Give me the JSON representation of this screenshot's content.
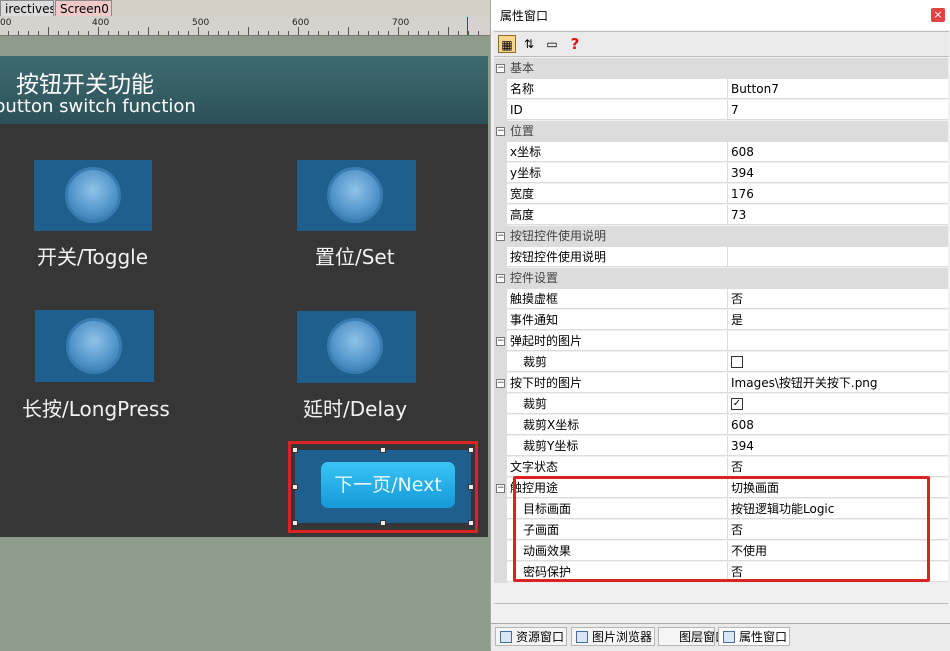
{
  "tabs": {
    "directives": "irectives",
    "screen0": "Screen0"
  },
  "ruler": {
    "labels": [
      "400",
      "500",
      "600",
      "700"
    ]
  },
  "screen": {
    "title_cn": "按钮开关功能",
    "title_en": "button switch function",
    "buttons": [
      {
        "caption": "开关/Toggle"
      },
      {
        "caption": "置位/Set"
      },
      {
        "caption": "长按/LongPress"
      },
      {
        "caption": "延时/Delay"
      }
    ],
    "next_label": "下一页/Next"
  },
  "prop_window": {
    "title": "属性窗口",
    "close": "×",
    "help": "?",
    "categories": {
      "basic": "基本",
      "position": "位置",
      "usage": "按钮控件使用说明",
      "settings": "控件设置"
    },
    "rows": {
      "name_label": "名称",
      "name_value": "Button7",
      "id_label": "ID",
      "id_value": "7",
      "x_label": "x坐标",
      "x_value": "608",
      "y_label": "y坐标",
      "y_value": "394",
      "w_label": "宽度",
      "w_value": "176",
      "h_label": "高度",
      "h_value": "73",
      "usage_label": "按钮控件使用说明",
      "usage_value": "",
      "touch_label": "触摸虚框",
      "touch_value": "否",
      "event_label": "事件通知",
      "event_value": "是",
      "popup_img_label": "弹起时的图片",
      "popup_img_value": "",
      "popup_crop_label": "裁剪",
      "press_img_label": "按下时的图片",
      "press_img_value": "Images\\按钮开关按下.png",
      "press_crop_label": "裁剪",
      "crop_x_label": "裁剪X坐标",
      "crop_x_value": "608",
      "crop_y_label": "裁剪Y坐标",
      "crop_y_value": "394",
      "text_state_label": "文字状态",
      "text_state_value": "否",
      "touch_use_label": "触控用途",
      "touch_use_value": "切换画面",
      "target_label": "目标画面",
      "target_value": "按钮逻辑功能Logic",
      "subscreen_label": "子画面",
      "subscreen_value": "否",
      "anim_label": "动画效果",
      "anim_value": "不使用",
      "pwd_label": "密码保护",
      "pwd_value": "否"
    },
    "checkboxes": {
      "popup_crop_checked": false,
      "press_crop_checked": true,
      "check_mark": "✓"
    },
    "bottom_tabs": [
      "资源窗口",
      "图片浏览器",
      "图层窗口",
      "属性窗口"
    ]
  }
}
